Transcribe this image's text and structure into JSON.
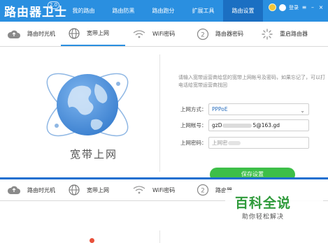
{
  "app": {
    "title": "路由器卫士",
    "version": "2.0"
  },
  "nav": {
    "items": [
      {
        "label": "我的路由"
      },
      {
        "label": "路由防黑"
      },
      {
        "label": "路由跑分"
      },
      {
        "label": "扩展工具"
      },
      {
        "label": "路由设置"
      }
    ],
    "active_index": 4
  },
  "header_right": {
    "login_label": "登录"
  },
  "tabs": [
    {
      "label": "路由时光机",
      "icon": "cloud-icon"
    },
    {
      "label": "宽带上网",
      "icon": "globe-icon"
    },
    {
      "label": "WiFi密码",
      "icon": "wifi-icon"
    },
    {
      "label": "路由器密码",
      "icon": "key-icon"
    },
    {
      "label": "重启路由器",
      "icon": "restart-icon"
    }
  ],
  "active_tab_index": 1,
  "main": {
    "caption": "宽带上网",
    "hint": "请输入宽带运营商给您的宽带上网帐号及密码，如果忘记了，可以打电话给宽带运营商找回",
    "connection_type_label": "上网方式：",
    "connection_type_value": "PPPoE",
    "account_label": "上网帐号：",
    "account_prefix": "gzD",
    "account_suffix": "5@163.gd",
    "password_label": "上网密码：",
    "password_value": "上网密",
    "save_button": "保存设置"
  },
  "tabs_repeat": [
    {
      "label": "路由时光机",
      "icon": "cloud-icon"
    },
    {
      "label": "宽带上网",
      "icon": "globe-icon"
    },
    {
      "label": "WiFi密码",
      "icon": "wifi-icon"
    },
    {
      "label": "路由器",
      "icon": "key-icon"
    }
  ],
  "watermark": {
    "title": "百科全说",
    "subtitle": "助你轻松解决"
  },
  "colors": {
    "nav_blue": "#2a8fe0",
    "nav_active": "#1b6fc2",
    "save_green": "#3dbf48",
    "watermark_green": "#2e9a3a",
    "globe_blue": "#4a8fd6"
  }
}
